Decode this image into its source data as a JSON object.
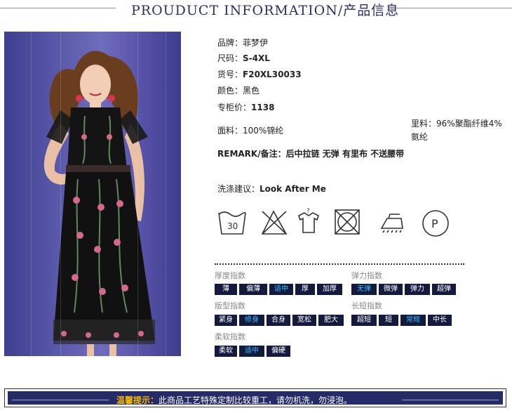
{
  "header": {
    "title": "PROUDUCT INFORMATION/产品信息"
  },
  "product": {
    "brand_label": "品牌：",
    "brand": "菲梦伊",
    "size_label": "尺码：",
    "size": "S-4XL",
    "sku_label": "货号：",
    "sku": "F20XL30033",
    "color_label": "颜色：",
    "color": "黑色",
    "price_label": "专柜价：",
    "price": "1138",
    "fabric_label": "面料：",
    "fabric": "100%锦纶",
    "lining_label": "里料：",
    "lining": "96%聚酯纤维4%",
    "lining_cont": "氨纶",
    "remark_label": "REMARK/备注：",
    "remark": "后中拉链 无弹 有里布 不送腰带",
    "wash_label": "洗涤建议：",
    "wash": "Look After Me"
  },
  "care_icons": [
    {
      "name": "wash-30-icon",
      "text": "30"
    },
    {
      "name": "no-bleach-icon"
    },
    {
      "name": "hang-dry-icon",
      "text": "?"
    },
    {
      "name": "no-tumble-dry-icon"
    },
    {
      "name": "iron-icon"
    },
    {
      "name": "dry-clean-p-icon",
      "text": "P"
    }
  ],
  "indices": {
    "thickness": {
      "label": "厚度指数",
      "options": [
        "薄",
        "偏薄",
        "适中",
        "厚",
        "加厚"
      ],
      "selected": "适中"
    },
    "elasticity": {
      "label": "弹力指数",
      "options": [
        "无弹",
        "微弹",
        "弹力",
        "超弹"
      ],
      "selected": "无弹"
    },
    "fit": {
      "label": "版型指数",
      "options": [
        "紧身",
        "修身",
        "合身",
        "宽松",
        "肥大"
      ],
      "selected": "修身"
    },
    "length": {
      "label": "长短指数",
      "options": [
        "超短",
        "短",
        "常规",
        "中长"
      ],
      "selected": "常规"
    },
    "softness": {
      "label": "柔软指数",
      "options": [
        "柔软",
        "适中",
        "偏硬"
      ],
      "selected": "适中"
    }
  },
  "footer": {
    "highlight": "温馨提示：",
    "text": "此商品工艺特殊定制比较重工，请勿机洗，勿浸泡。"
  },
  "colors": {
    "navy": "#141a3d",
    "active": "#29c3ff",
    "title": "#2b2f6a",
    "footer_bg": "#252b67",
    "footer_hl": "#f6b800"
  }
}
